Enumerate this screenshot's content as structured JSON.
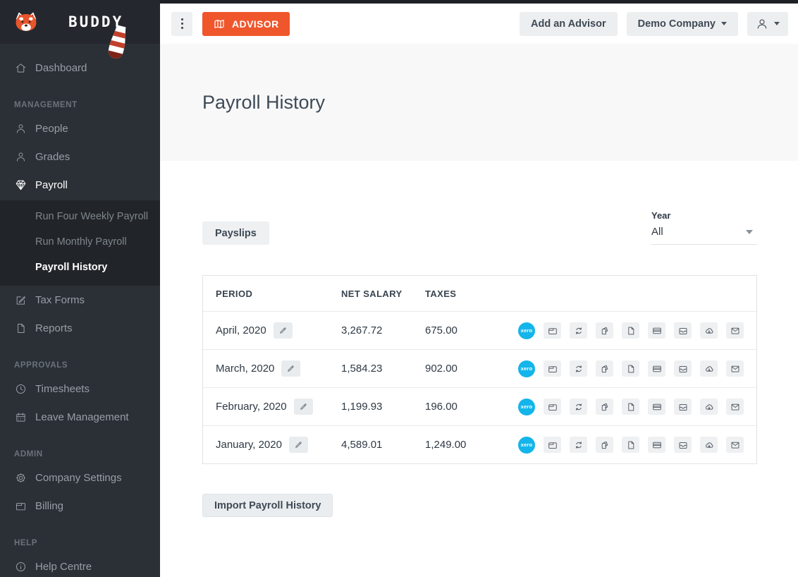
{
  "sidebar": {
    "brand": "BUDDY",
    "items": {
      "dashboard": "Dashboard",
      "management_header": "MANAGEMENT",
      "people": "People",
      "grades": "Grades",
      "payroll": "Payroll",
      "run_four_weekly": "Run Four Weekly Payroll",
      "run_monthly": "Run Monthly Payroll",
      "payroll_history": "Payroll History",
      "tax_forms": "Tax Forms",
      "reports": "Reports",
      "approvals_header": "APPROVALS",
      "timesheets": "Timesheets",
      "leave_management": "Leave Management",
      "admin_header": "ADMIN",
      "company_settings": "Company Settings",
      "billing": "Billing",
      "help_header": "HELP",
      "help_centre": "Help Centre"
    }
  },
  "topbar": {
    "advisor_label": "ADVISOR",
    "add_advisor_label": "Add an Advisor",
    "company_label": "Demo Company"
  },
  "page": {
    "title": "Payroll History"
  },
  "toolbar": {
    "payslips_label": "Payslips",
    "year_label": "Year",
    "year_value": "All"
  },
  "table": {
    "columns": [
      "PERIOD",
      "NET SALARY",
      "TAXES"
    ],
    "xero_badge_text": "xero",
    "row_action_icons": [
      "xero-badge",
      "wallet-icon",
      "sync-icon",
      "copy-icon",
      "file-icon",
      "credit-card-icon",
      "inbox-icon",
      "cloud-download-icon",
      "mail-icon"
    ],
    "rows": [
      {
        "period": "April, 2020",
        "net_salary": "3,267.72",
        "taxes": "675.00"
      },
      {
        "period": "March, 2020",
        "net_salary": "1,584.23",
        "taxes": "902.00"
      },
      {
        "period": "February, 2020",
        "net_salary": "1,199.93",
        "taxes": "196.00"
      },
      {
        "period": "January, 2020",
        "net_salary": "4,589.01",
        "taxes": "1,249.00"
      }
    ]
  },
  "actions": {
    "import_label": "Import Payroll History"
  },
  "colors": {
    "accent_orange": "#f0562b",
    "xero_cyan": "#13b5ea",
    "sidebar_bg": "#2b3036",
    "band_gray": "#f8f8f9"
  }
}
